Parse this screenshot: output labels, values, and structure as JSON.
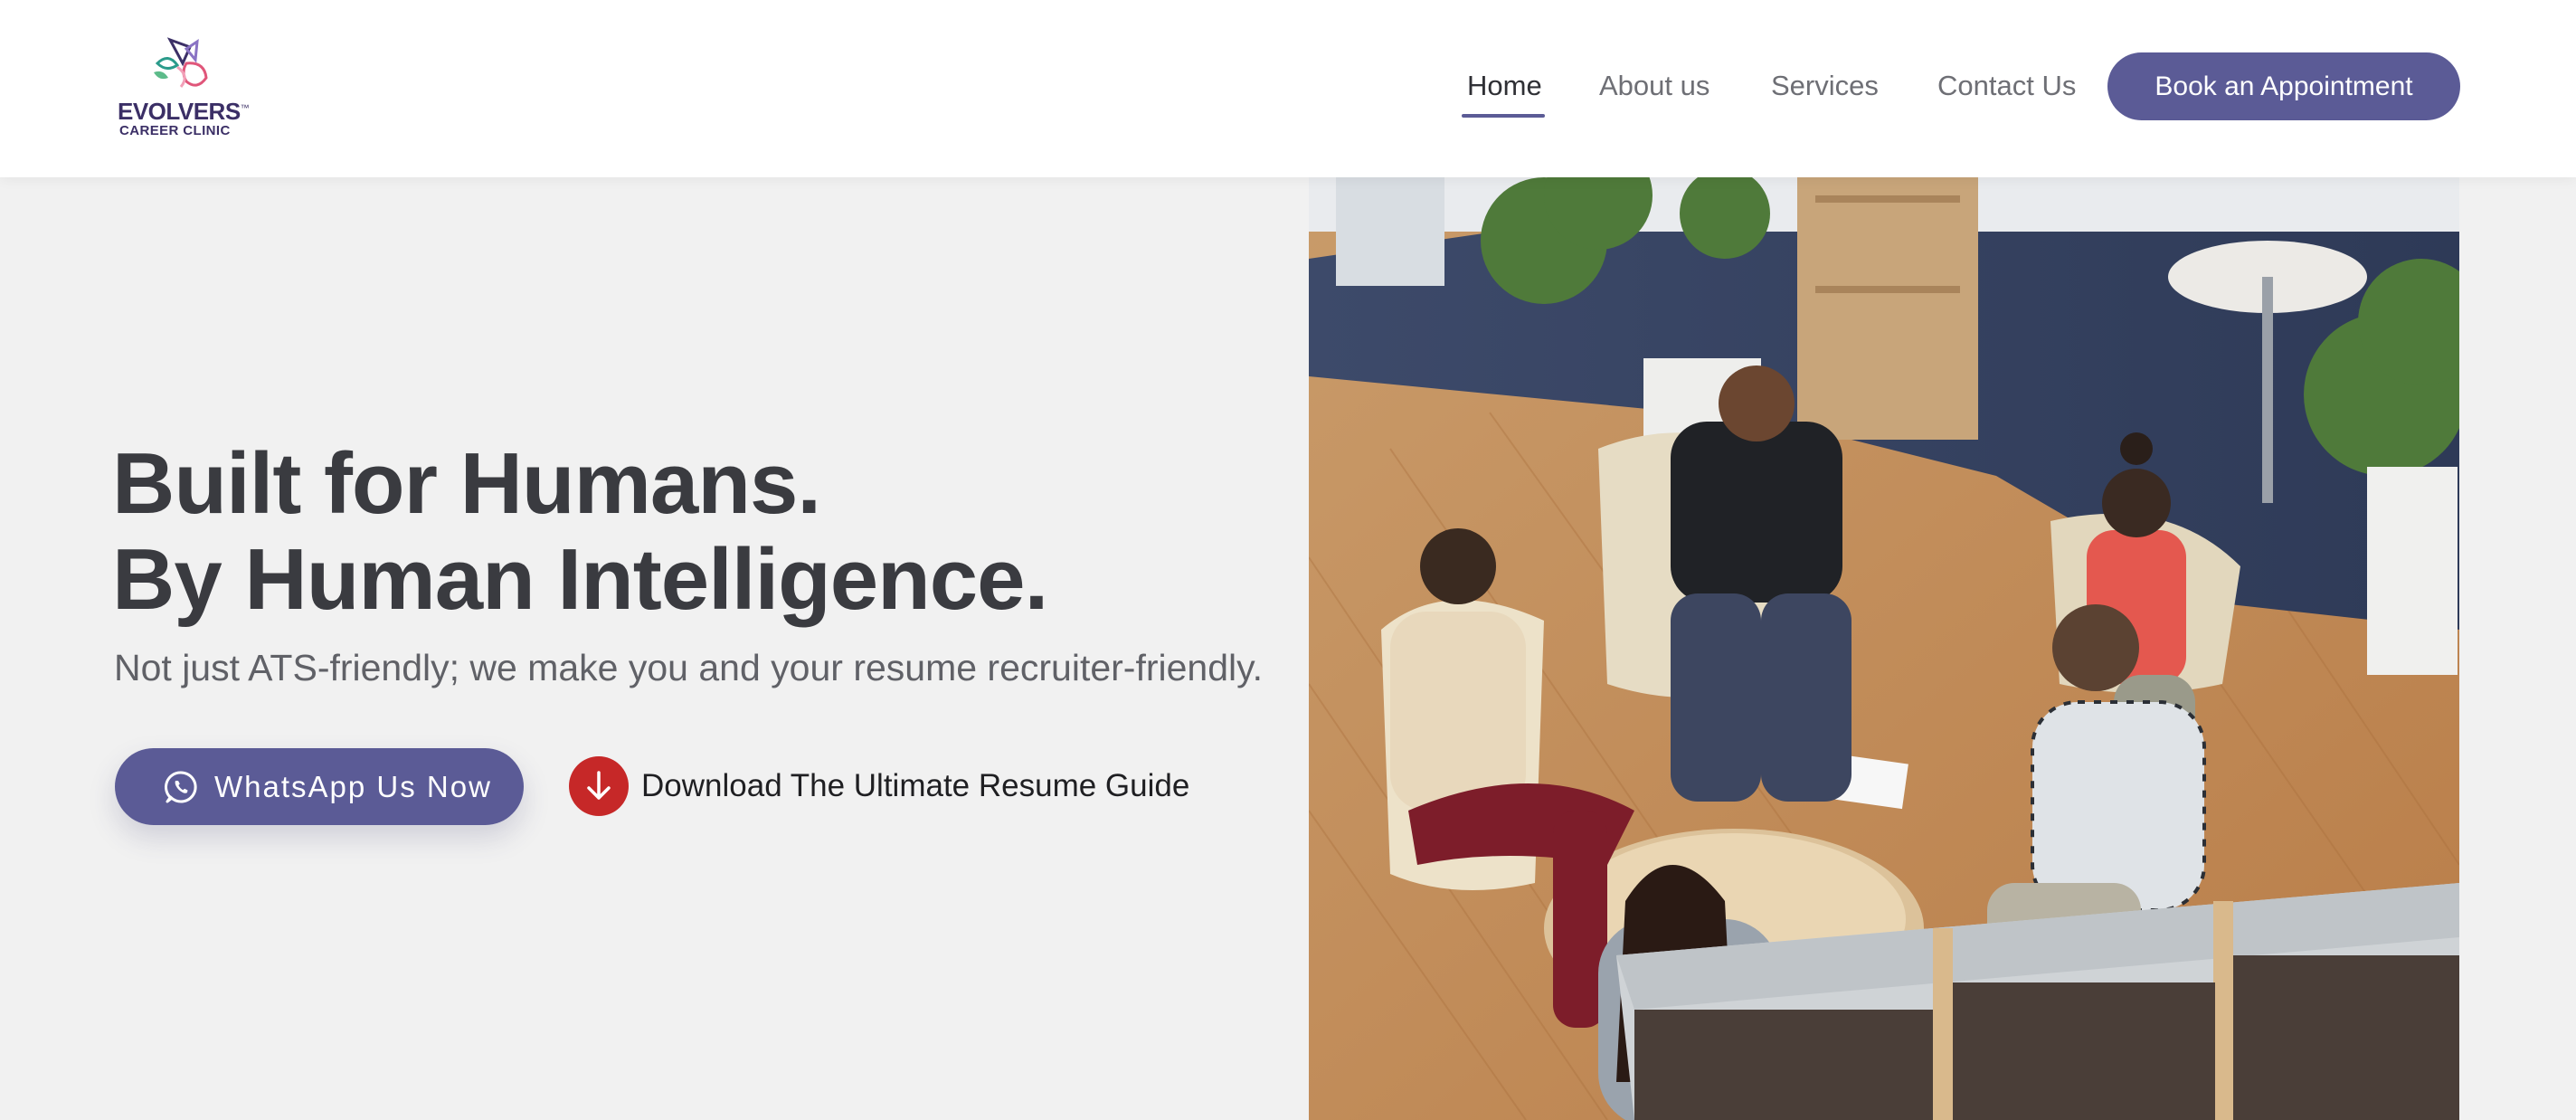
{
  "brand": {
    "name": "EVOLVERS",
    "trademark": "™",
    "tagline": "CAREER CLINIC"
  },
  "nav": {
    "items": [
      {
        "label": "Home",
        "active": true
      },
      {
        "label": "About us",
        "active": false
      },
      {
        "label": "Services",
        "active": false
      },
      {
        "label": "Contact Us",
        "active": false
      }
    ],
    "cta_label": "Book an Appointment"
  },
  "hero": {
    "title_line1": "Built for Humans.",
    "title_line2": "By Human Intelligence.",
    "subtitle": "Not just ATS-friendly; we make you and your resume recruiter-friendly.",
    "whatsapp_label": "WhatsApp Us Now",
    "download_label": "Download The Ultimate Resume Guide"
  },
  "icons": {
    "logo": "butterfly-logo-icon",
    "whatsapp": "whatsapp-icon",
    "download": "arrow-down-icon"
  },
  "colors": {
    "accent": "#5b5b96",
    "download": "#c62828",
    "background": "#f1f1f1",
    "heading": "#3a3b40"
  }
}
